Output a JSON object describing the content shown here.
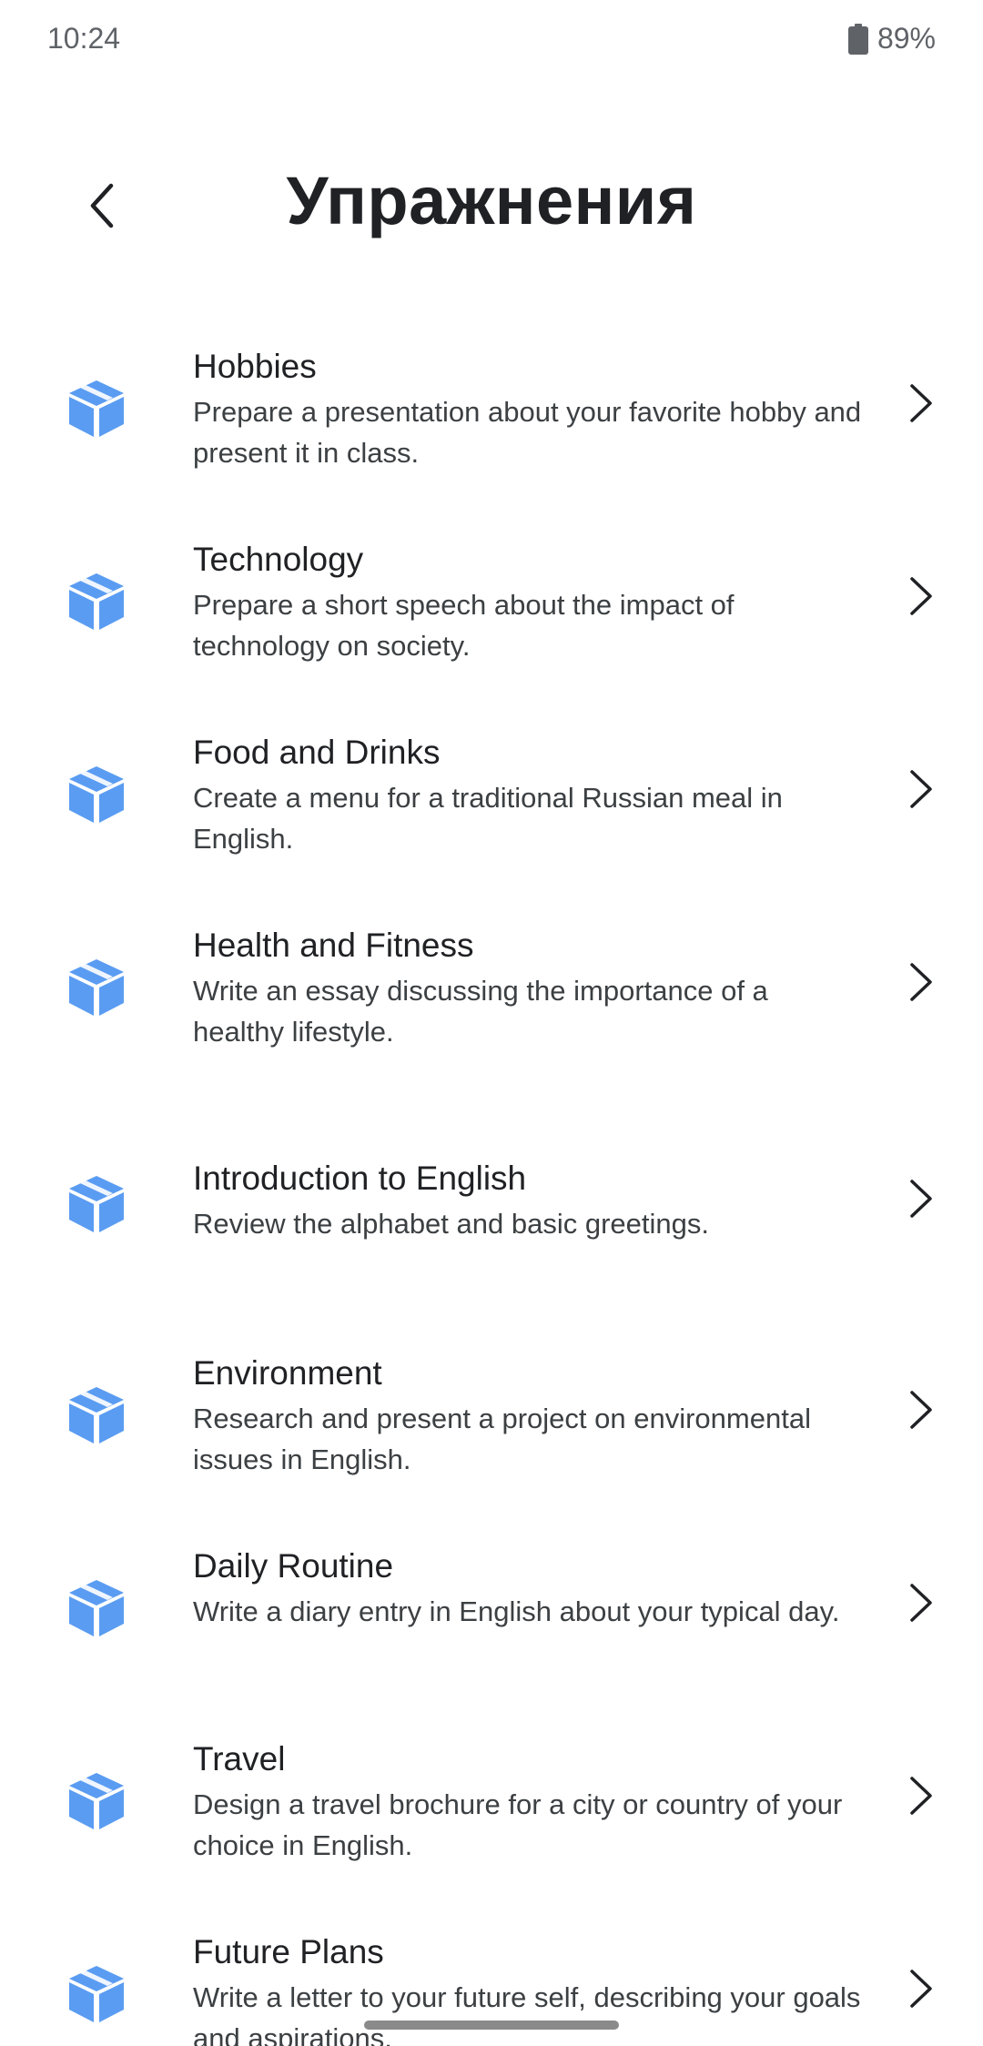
{
  "status_bar": {
    "time": "10:24",
    "battery": "89%",
    "battery_icon": "battery-icon"
  },
  "header": {
    "back_icon": "chevron-left-icon",
    "title": "Упражнения"
  },
  "colors": {
    "icon_blue": "#5a9cf2",
    "text_primary": "#202124",
    "text_secondary": "#3c4043"
  },
  "exercises": [
    {
      "title": "Hobbies",
      "description": "Prepare a presentation about your favorite hobby and present it in class."
    },
    {
      "title": "Technology",
      "description": "Prepare a short speech about the impact of technology on society."
    },
    {
      "title": "Food and Drinks",
      "description": "Create a menu for a traditional Russian meal in English."
    },
    {
      "title": "Health and Fitness",
      "description": "Write an essay discussing the importance of a healthy lifestyle."
    },
    {
      "title": "Introduction to English",
      "description": "Review the alphabet and basic greetings."
    },
    {
      "title": "Environment",
      "description": "Research and present a project on environmental issues in English."
    },
    {
      "title": "Daily Routine",
      "description": "Write a diary entry in English about your typical day."
    },
    {
      "title": "Travel",
      "description": "Design a travel brochure for a city or country of your choice in English."
    },
    {
      "title": "Future Plans",
      "description": "Write a letter to your future self, describing your goals and aspirations."
    }
  ]
}
